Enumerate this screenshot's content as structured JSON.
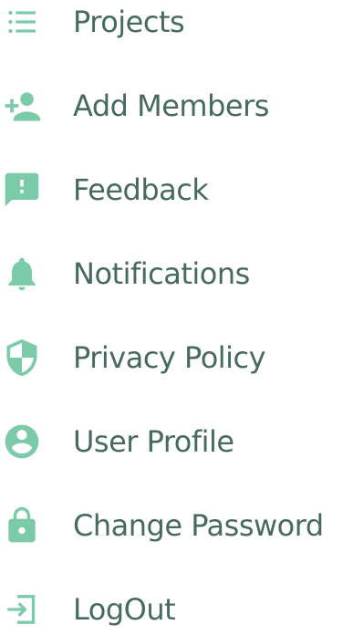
{
  "menu": {
    "accent_color": "#7ccba8",
    "text_color": "#466a5f",
    "items": [
      {
        "label": "Projects",
        "icon": "list-icon"
      },
      {
        "label": "Add Members",
        "icon": "add-person-icon"
      },
      {
        "label": "Feedback",
        "icon": "feedback-icon"
      },
      {
        "label": "Notifications",
        "icon": "bell-icon"
      },
      {
        "label": "Privacy Policy",
        "icon": "shield-icon"
      },
      {
        "label": "User Profile",
        "icon": "account-circle-icon"
      },
      {
        "label": "Change Password",
        "icon": "lock-icon"
      },
      {
        "label": "LogOut",
        "icon": "login-arrow-icon"
      }
    ]
  }
}
